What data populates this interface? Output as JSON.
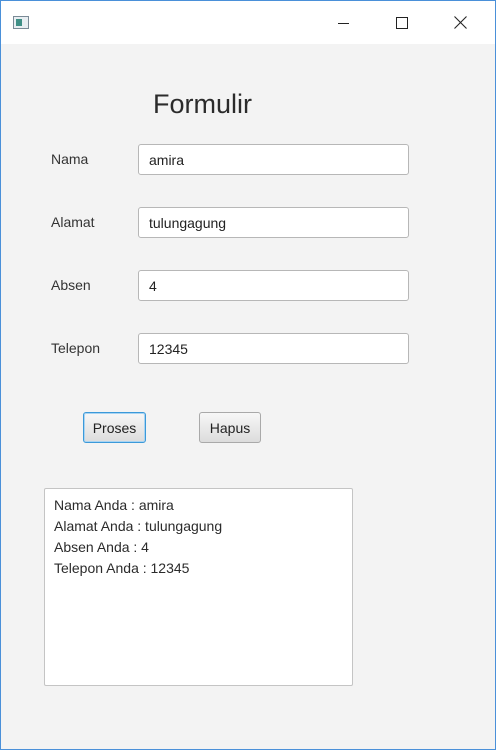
{
  "form": {
    "title": "Formulir",
    "fields": [
      {
        "label": "Nama",
        "value": "amira"
      },
      {
        "label": "Alamat",
        "value": "tulungagung"
      },
      {
        "label": "Absen",
        "value": "4"
      },
      {
        "label": "Telepon",
        "value": "12345"
      }
    ],
    "buttons": {
      "proses": "Proses",
      "hapus": "Hapus"
    }
  },
  "output": {
    "lines": [
      "Nama Anda : amira",
      "Alamat Anda : tulungagung",
      "Absen Anda : 4",
      "Telepon Anda : 12345"
    ]
  },
  "window": {
    "controls": [
      "minimize-icon",
      "maximize-icon",
      "close-icon"
    ],
    "accent": "#3b99d9"
  }
}
